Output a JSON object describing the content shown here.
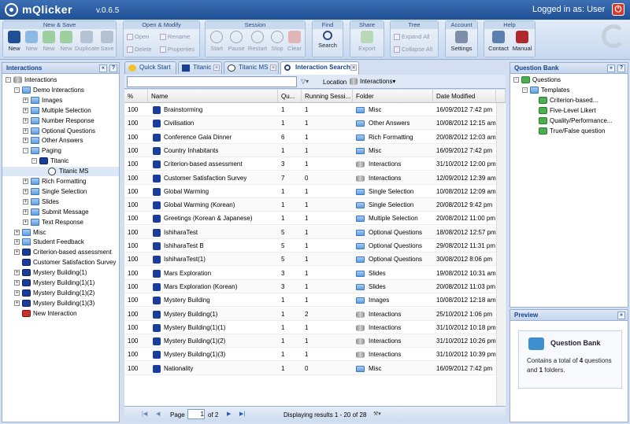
{
  "app": {
    "name": "mQlicker",
    "version": "v.0.6.5",
    "logged_in": "Logged in as: User"
  },
  "toolbar": {
    "groups": {
      "new_save": "New & Save",
      "open_modify": "Open & Modify",
      "session": "Session",
      "find": "Find",
      "share": "Share",
      "tree": "Tree",
      "account": "Account",
      "help": "Help"
    },
    "new": [
      "New",
      "New",
      "New",
      "New",
      "Duplicate",
      "Save"
    ],
    "open_modify": {
      "open": "Open",
      "rename": "Rename",
      "delete": "Delete",
      "properties": "Properties"
    },
    "session": [
      "Start",
      "Pause",
      "Restart",
      "Stop",
      "Clear"
    ],
    "find": "Search",
    "share": "Export",
    "tree": {
      "expand": "Expand All",
      "collapse": "Collapse All"
    },
    "account": "Settings",
    "help": [
      "Contact",
      "Manual"
    ]
  },
  "interactions_panel": {
    "title": "Interactions",
    "tree": [
      {
        "label": "Interactions",
        "icon": "db"
      },
      {
        "label": "Demo Interactions",
        "icon": "folder"
      },
      {
        "label": "Images",
        "icon": "folder"
      },
      {
        "label": "Multiple Selection",
        "icon": "folder"
      },
      {
        "label": "Number Response",
        "icon": "folder"
      },
      {
        "label": "Optional Questions",
        "icon": "folder"
      },
      {
        "label": "Other Answers",
        "icon": "folder"
      },
      {
        "label": "Paging",
        "icon": "folder"
      },
      {
        "label": "Titanic",
        "icon": "interaction"
      },
      {
        "label": "Titanic MS",
        "icon": "play"
      },
      {
        "label": "Rich Formatting",
        "icon": "folder"
      },
      {
        "label": "Single Selection",
        "icon": "folder"
      },
      {
        "label": "Slides",
        "icon": "folder"
      },
      {
        "label": "Submit Message",
        "icon": "folder"
      },
      {
        "label": "Text Response",
        "icon": "folder"
      },
      {
        "label": "Misc",
        "icon": "folder"
      },
      {
        "label": "Student Feedback",
        "icon": "folder"
      },
      {
        "label": "Criterion-based assessment",
        "icon": "interaction"
      },
      {
        "label": "Customer Satisfaction Survey",
        "icon": "interaction"
      },
      {
        "label": "Mystery Building(1)",
        "icon": "interaction"
      },
      {
        "label": "Mystery Building(1)(1)",
        "icon": "interaction"
      },
      {
        "label": "Mystery Building(1)(2)",
        "icon": "interaction"
      },
      {
        "label": "Mystery Building(1)(3)",
        "icon": "interaction"
      },
      {
        "label": "New Interaction",
        "icon": "red"
      }
    ]
  },
  "tabs": [
    "Quick Start",
    "Titanic",
    "Titanic MS",
    "Interaction Search"
  ],
  "search": {
    "value": "",
    "location_label": "Location",
    "location_value": "Interactions"
  },
  "grid": {
    "columns": [
      "%",
      "Name",
      "Qu...",
      "Running Sessi...",
      "Folder",
      "Date Modified"
    ],
    "rows": [
      [
        "100",
        "Brainstorming",
        "1",
        "1",
        "Misc",
        "16/09/2012 7:42 pm"
      ],
      [
        "100",
        "Civilisation",
        "1",
        "1",
        "Other Answers",
        "10/08/2012 12:15 am"
      ],
      [
        "100",
        "Conference Gala Dinner",
        "6",
        "1",
        "Rich Formatting",
        "20/08/2012 12:03 am"
      ],
      [
        "100",
        "Country Inhabitants",
        "1",
        "1",
        "Misc",
        "16/09/2012 7:42 pm"
      ],
      [
        "100",
        "Criterion-based assessment",
        "3",
        "1",
        "Interactions",
        "31/10/2012 12:00 pm"
      ],
      [
        "100",
        "Customer Satisfaction Survey",
        "7",
        "0",
        "Interactions",
        "12/09/2012 12:39 am"
      ],
      [
        "100",
        "Global Warming",
        "1",
        "1",
        "Single Selection",
        "10/08/2012 12:09 am"
      ],
      [
        "100",
        "Global Warming (Korean)",
        "1",
        "1",
        "Single Selection",
        "20/08/2012 9:42 pm"
      ],
      [
        "100",
        "Greetings (Korean & Japanese)",
        "1",
        "1",
        "Multiple Selection",
        "20/08/2012 11:00 pm"
      ],
      [
        "100",
        "IshiharaTest",
        "5",
        "1",
        "Optional Questions",
        "18/08/2012 12:57 pm"
      ],
      [
        "100",
        "IshiharaTest B",
        "5",
        "1",
        "Optional Questions",
        "29/08/2012 11:31 pm"
      ],
      [
        "100",
        "IshiharaTest(1)",
        "5",
        "1",
        "Optional Questions",
        "30/08/2012 8:06 pm"
      ],
      [
        "100",
        "Mars Exploration",
        "3",
        "1",
        "Slides",
        "19/08/2012 10:31 am"
      ],
      [
        "100",
        "Mars Exploration (Korean)",
        "3",
        "1",
        "Slides",
        "20/08/2012 11:03 pm"
      ],
      [
        "100",
        "Mystery Building",
        "1",
        "1",
        "Images",
        "10/08/2012 12:18 am"
      ],
      [
        "100",
        "Mystery Building(1)",
        "1",
        "2",
        "Interactions",
        "25/10/2012 1:06 pm"
      ],
      [
        "100",
        "Mystery Building(1)(1)",
        "1",
        "1",
        "Interactions",
        "31/10/2012 10:18 pm"
      ],
      [
        "100",
        "Mystery Building(1)(2)",
        "1",
        "1",
        "Interactions",
        "31/10/2012 10:26 pm"
      ],
      [
        "100",
        "Mystery Building(1)(3)",
        "1",
        "1",
        "Interactions",
        "31/10/2012 10:39 pm"
      ],
      [
        "100",
        "Nationality",
        "1",
        "0",
        "Misc",
        "16/09/2012 7:42 pm"
      ]
    ]
  },
  "pager": {
    "page_label": "Page",
    "page": "1",
    "of": "of 2",
    "display": "Displaying results 1 - 20 of 28"
  },
  "question_bank": {
    "title": "Question Bank",
    "tree": [
      "Questions",
      "Templates",
      "Criterion-based...",
      "Five-Level Likert",
      "Quality/Performance...",
      "True/False question"
    ]
  },
  "preview": {
    "title": "Preview",
    "heading": "Question Bank",
    "text_pre": "Contains a total of ",
    "questions": "4",
    "text_mid": " questions and ",
    "folders": "1",
    "text_post": " folders."
  }
}
